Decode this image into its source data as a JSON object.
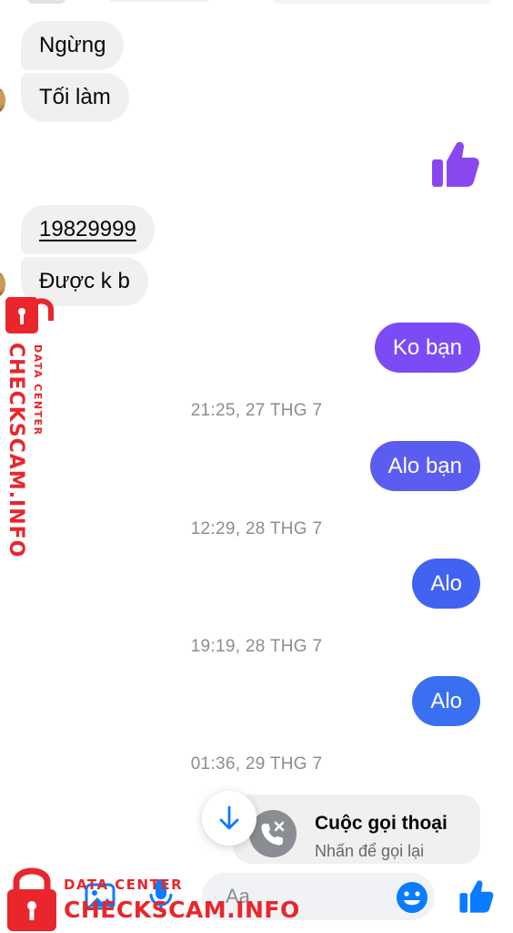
{
  "messages": [
    {
      "dir": "in",
      "text": "Ngừng"
    },
    {
      "dir": "in",
      "text": "Tối làm"
    },
    {
      "dir": "out",
      "type": "like"
    },
    {
      "dir": "in",
      "text": "19829999"
    },
    {
      "dir": "in",
      "text": "Được k b"
    },
    {
      "dir": "out",
      "text": "Ko bạn"
    },
    {
      "type": "timestamp",
      "text": "21:25, 27 THG 7"
    },
    {
      "dir": "out",
      "text": "Alo bạn"
    },
    {
      "type": "timestamp",
      "text": "12:29, 28 THG 7"
    },
    {
      "dir": "out",
      "text": "Alo"
    },
    {
      "type": "timestamp",
      "text": "19:19, 28 THG 7"
    },
    {
      "dir": "out",
      "text": "Alo"
    },
    {
      "type": "timestamp",
      "text": "01:36, 29 THG 7"
    }
  ],
  "call_card": {
    "title": "Cuộc gọi thoại",
    "subtitle": "Nhấn để gọi lại"
  },
  "composer": {
    "placeholder": "Aa"
  },
  "icons": {
    "like": "thumbs-up-icon",
    "emoji": "smiley-icon",
    "missed_call": "missed-call-icon",
    "scroll_down": "arrow-down-icon",
    "photo": "photo-icon",
    "mic": "microphone-icon",
    "lock": "padlock-icon"
  },
  "watermark": {
    "brand": "CHECKSCAM.INFO",
    "tagline": "DATA CENTER"
  },
  "colors": {
    "incoming_bubble": "#f0f0f0",
    "outgoing_purple": "#7b4cf5",
    "outgoing_indigo": "#5b5cf0",
    "outgoing_blue": "#3a6ff2",
    "like_purple": "#8a47f0",
    "messenger_blue": "#0a7cff",
    "watermark_red": "#e8262c",
    "timestamp_gray": "#8a8d91"
  }
}
